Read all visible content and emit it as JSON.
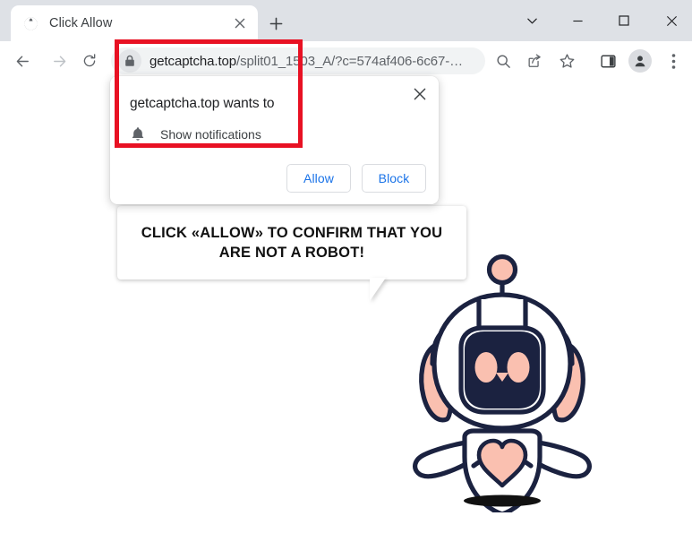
{
  "window": {
    "controls": [
      {
        "name": "tab-search",
        "glyph": "chevron-down-icon"
      },
      {
        "name": "minimize",
        "glyph": "minimize-icon"
      },
      {
        "name": "maximize",
        "glyph": "maximize-icon"
      },
      {
        "name": "close",
        "glyph": "close-icon"
      }
    ]
  },
  "tab": {
    "title": "Click Allow",
    "favicon": "globe-icon",
    "close_label": "×",
    "new_tab_label": "+"
  },
  "toolbar": {
    "back": "back-arrow-icon",
    "forward": "forward-arrow-icon",
    "reload": "reload-icon",
    "omnibox": {
      "lock_icon": "lock-icon",
      "url_host": "getcaptcha.top",
      "url_path": "/split01_1503_A/?c=574af406-6c67-…",
      "full_url": "getcaptcha.top/split01_1503_A/?c=574af406-6c67-…"
    },
    "icons": [
      "search-icon",
      "share-icon",
      "bookmark-star-icon",
      "side-panel-icon",
      "profile-avatar-icon",
      "three-dot-menu-icon"
    ]
  },
  "permission_dialog": {
    "heading": "getcaptcha.top wants to",
    "permission_icon": "bell-icon",
    "permission_label": "Show notifications",
    "close_label": "✕",
    "allow_label": "Allow",
    "block_label": "Block",
    "accent_color": "#1a73e8"
  },
  "highlight": {
    "color": "#e81123",
    "target": "address-bar-and-permission-prompt"
  },
  "speech_bubble": {
    "line1": "CLICK «ALLOW» TO CONFIRM THAT YOU",
    "line2": "ARE NOT A ROBOT!",
    "text": "CLICK «ALLOW» TO CONFIRM THAT YOU ARE NOT A ROBOT!"
  },
  "robot": {
    "name": "robot-mascot",
    "outline_color": "#1b2240",
    "accent_color": "#fac0b0",
    "body_color": "#ffffff",
    "shadow_color": "#111111"
  }
}
